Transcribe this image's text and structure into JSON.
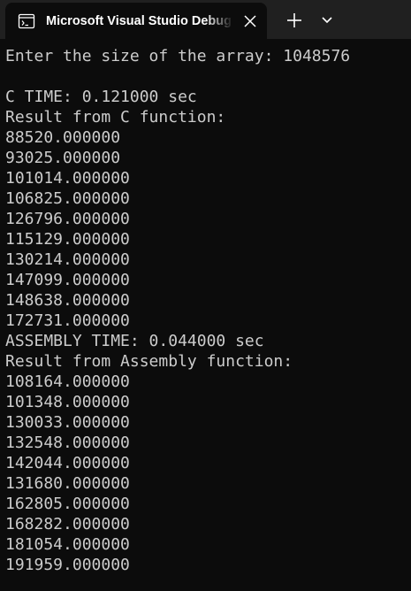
{
  "window": {
    "tab_title": "Microsoft Visual Studio Debug Console",
    "icons": {
      "tab": "console-icon",
      "close": "close-icon",
      "new_tab": "plus-icon",
      "dropdown": "chevron-down-icon"
    }
  },
  "console": {
    "lines": [
      "Enter the size of the array: 1048576",
      "",
      "C TIME: 0.121000 sec",
      "Result from C function:",
      "88520.000000",
      "93025.000000",
      "101014.000000",
      "106825.000000",
      "126796.000000",
      "115129.000000",
      "130214.000000",
      "147099.000000",
      "148638.000000",
      "172731.000000",
      "ASSEMBLY TIME: 0.044000 sec",
      "Result from Assembly function:",
      "108164.000000",
      "101348.000000",
      "130033.000000",
      "132548.000000",
      "142044.000000",
      "131680.000000",
      "162805.000000",
      "168282.000000",
      "181054.000000",
      "191959.000000"
    ]
  },
  "colors": {
    "background": "#0c0c0c",
    "titlebar": "#202020",
    "text": "#cccccc"
  }
}
